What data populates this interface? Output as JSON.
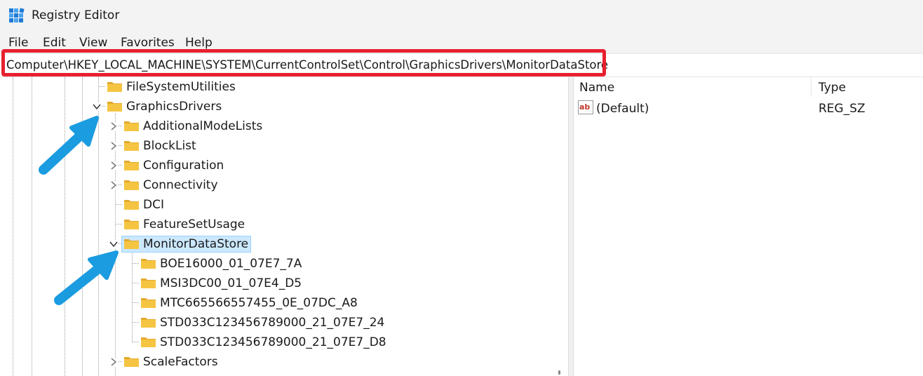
{
  "window": {
    "title": "Registry Editor"
  },
  "menu": [
    {
      "label": "File"
    },
    {
      "label": "Edit"
    },
    {
      "label": "View"
    },
    {
      "label": "Favorites"
    },
    {
      "label": "Help"
    }
  ],
  "address": {
    "path": "Computer\\HKEY_LOCAL_MACHINE\\SYSTEM\\CurrentControlSet\\Control\\GraphicsDrivers\\MonitorDataStore"
  },
  "tree": {
    "items": [
      {
        "label": "FileSystemUtilities",
        "expander": "none"
      },
      {
        "label": "GraphicsDrivers",
        "expander": "expanded"
      },
      {
        "label": "AdditionalModeLists",
        "expander": "collapsed"
      },
      {
        "label": "BlockList",
        "expander": "collapsed"
      },
      {
        "label": "Configuration",
        "expander": "collapsed"
      },
      {
        "label": "Connectivity",
        "expander": "collapsed"
      },
      {
        "label": "DCI",
        "expander": "none"
      },
      {
        "label": "FeatureSetUsage",
        "expander": "none"
      },
      {
        "label": "MonitorDataStore",
        "expander": "expanded",
        "selected": true
      },
      {
        "label": "BOE16000_01_07E7_7A",
        "expander": "none"
      },
      {
        "label": "MSI3DC00_01_07E4_D5",
        "expander": "none"
      },
      {
        "label": "MTC665566557455_0E_07DC_A8",
        "expander": "none"
      },
      {
        "label": "STD033C123456789000_21_07E7_24",
        "expander": "none"
      },
      {
        "label": "STD033C123456789000_21_07E7_D8",
        "expander": "none"
      },
      {
        "label": "ScaleFactors",
        "expander": "collapsed"
      }
    ]
  },
  "values": {
    "columns": [
      {
        "label": "Name"
      },
      {
        "label": "Type"
      }
    ],
    "rows": [
      {
        "name": "(Default)",
        "type": "REG_SZ",
        "icon": "string-value-icon"
      }
    ]
  },
  "colors": {
    "highlight": "#e8202f",
    "arrow": "#1b9be0",
    "folder": "#f5c542",
    "selection": "#cce8ff"
  },
  "icons": {
    "app": "registry-editor-icon",
    "folder": "folder-icon",
    "expanded": "chevron-down-icon",
    "collapsed": "chevron-right-icon"
  }
}
